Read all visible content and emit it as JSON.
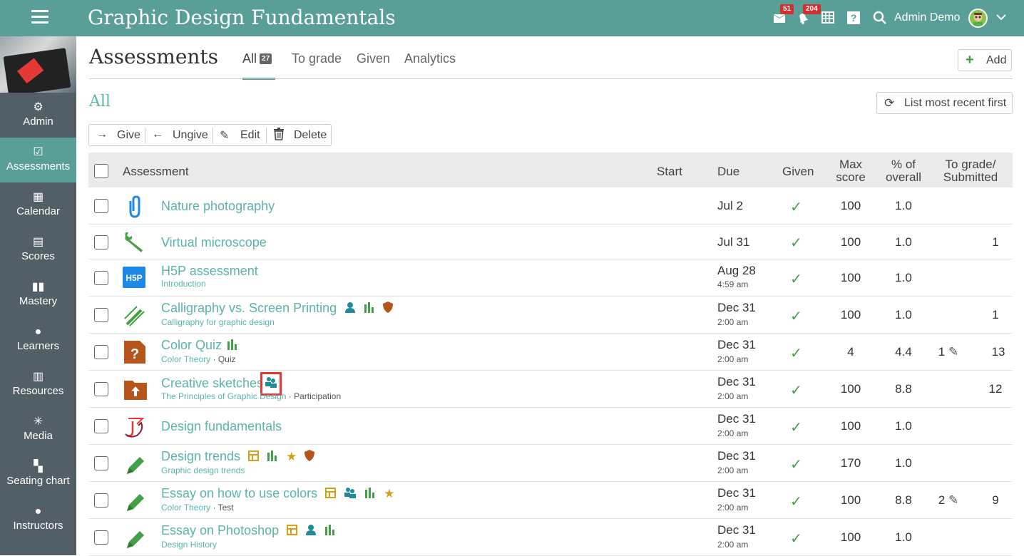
{
  "app": {
    "title": "Graphic Design Fundamentals"
  },
  "topbar": {
    "messages_badge": "51",
    "notifications_badge": "204",
    "user_name": "Admin Demo"
  },
  "sidebar": {
    "items": [
      {
        "label": "Admin",
        "icon": "gear-icon"
      },
      {
        "label": "Assessments",
        "icon": "checklist-icon"
      },
      {
        "label": "Calendar",
        "icon": "calendar-icon"
      },
      {
        "label": "Scores",
        "icon": "scores-icon"
      },
      {
        "label": "Mastery",
        "icon": "bar-chart-icon"
      },
      {
        "label": "Learners",
        "icon": "person-icon"
      },
      {
        "label": "Resources",
        "icon": "books-icon"
      },
      {
        "label": "Media",
        "icon": "sparkle-icon"
      },
      {
        "label": "Seating chart",
        "icon": "seating-icon"
      },
      {
        "label": "Instructors",
        "icon": "instructor-icon"
      }
    ]
  },
  "page": {
    "title": "Assessments",
    "section_title": "All"
  },
  "tabs": [
    {
      "label": "All",
      "count": "27"
    },
    {
      "label": "To grade"
    },
    {
      "label": "Given"
    },
    {
      "label": "Analytics"
    }
  ],
  "buttons": {
    "add": "Add",
    "sort": "List most recent first"
  },
  "actions": {
    "give": "Give",
    "ungive": "Ungive",
    "edit": "Edit",
    "delete": "Delete"
  },
  "table": {
    "headers": {
      "assessment": "Assessment",
      "start": "Start",
      "due": "Due",
      "given": "Given",
      "max_score_1": "Max",
      "max_score_2": "score",
      "percent_1": "% of",
      "percent_2": "overall",
      "tograde_1": "To grade/",
      "tograde_2": "Submitted"
    },
    "rows": [
      {
        "name": "Nature photography",
        "category": "",
        "type": "",
        "due": "Jul 2",
        "due_time": "",
        "max": "100",
        "percent": "1.0",
        "to_grade": "",
        "submitted": "",
        "icon": "paperclip-icon"
      },
      {
        "name": "Virtual microscope",
        "category": "",
        "type": "",
        "due": "Jul 31",
        "due_time": "",
        "max": "100",
        "percent": "1.0",
        "to_grade": "",
        "submitted": "1",
        "icon": "wrench-icon"
      },
      {
        "name": "H5P assessment",
        "category": "Introduction",
        "type": "",
        "due": "Aug 28",
        "due_time": "4:59 am",
        "max": "100",
        "percent": "1.0",
        "to_grade": "",
        "submitted": "",
        "icon": "h5p-icon"
      },
      {
        "name": "Calligraphy vs. Screen Printing",
        "category": "Calligraphy for graphic design",
        "type": "",
        "due": "Dec 31",
        "due_time": "2:00 am",
        "max": "100",
        "percent": "1.0",
        "to_grade": "",
        "submitted": "1",
        "icon": "no-edit-icon"
      },
      {
        "name": "Color Quiz",
        "category": "Color Theory",
        "type": "Quiz",
        "due": "Dec 31",
        "due_time": "2:00 am",
        "max": "4",
        "percent": "4.4",
        "to_grade": "1",
        "submitted": "13",
        "icon": "quiz-icon"
      },
      {
        "name": "Creative sketches",
        "category": "The Principles of Graphic Design",
        "type": "Participation",
        "due": "Dec 31",
        "due_time": "2:00 am",
        "max": "100",
        "percent": "8.8",
        "to_grade": "",
        "submitted": "12",
        "icon": "upload-folder-icon"
      },
      {
        "name": "Design fundamentals",
        "category": "",
        "type": "",
        "due": "Dec 31",
        "due_time": "2:00 am",
        "max": "100",
        "percent": "1.0",
        "to_grade": "",
        "submitted": "",
        "icon": "turnitin-icon"
      },
      {
        "name": "Design trends",
        "category": "Graphic design trends",
        "type": "",
        "due": "Dec 31",
        "due_time": "2:00 am",
        "max": "170",
        "percent": "1.0",
        "to_grade": "",
        "submitted": "",
        "icon": "pencil-icon"
      },
      {
        "name": "Essay on how to use colors",
        "category": "Color Theory",
        "type": "Test",
        "due": "Dec 31",
        "due_time": "2:00 am",
        "max": "100",
        "percent": "8.8",
        "to_grade": "2",
        "submitted": "9",
        "icon": "pencil-icon"
      },
      {
        "name": "Essay on Photoshop",
        "category": "Design History",
        "type": "",
        "due": "Dec 31",
        "due_time": "2:00 am",
        "max": "100",
        "percent": "1.0",
        "to_grade": "",
        "submitted": "",
        "icon": "pencil-icon"
      }
    ]
  },
  "colors": {
    "brand": "#5a9e98",
    "link": "#5ab4a8",
    "check": "#43a047",
    "badge": "#d32f2f"
  }
}
